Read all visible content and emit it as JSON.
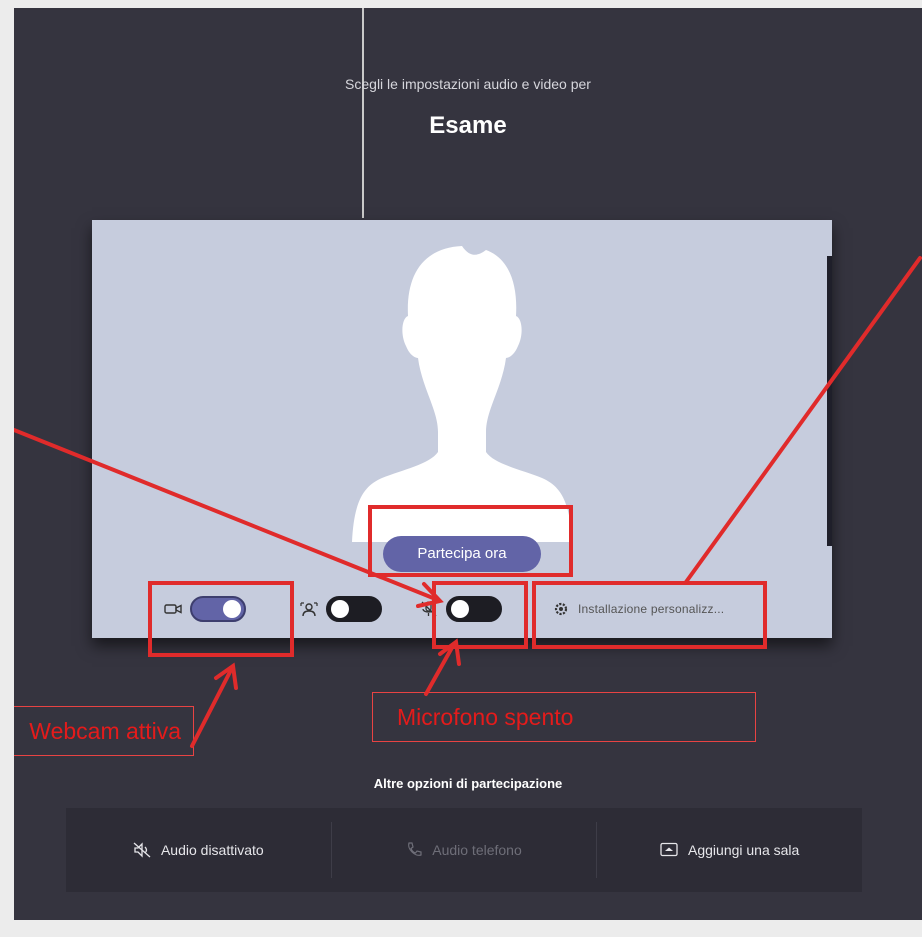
{
  "header": {
    "subtitle": "Scegli le impostazioni audio e video per",
    "meeting_title": "Esame"
  },
  "preview": {
    "join_label": "Partecipa ora",
    "controls": {
      "camera": {
        "state": "on",
        "icon": "camera-icon"
      },
      "background": {
        "state": "off",
        "icon": "background-blur-icon"
      },
      "microphone": {
        "state": "off",
        "icon": "microphone-icon"
      },
      "device": {
        "icon": "gear-icon",
        "label": "Installazione personalizz..."
      }
    }
  },
  "annotations": {
    "webcam_callout": "Webcam attiva",
    "microphone_callout": "Microfono spento",
    "color": "#e02b2b"
  },
  "more_options": {
    "heading": "Altre opzioni di partecipazione",
    "items": [
      {
        "label": "Audio disattivato",
        "icon": "speaker-off-icon",
        "enabled": true
      },
      {
        "label": "Audio telefono",
        "icon": "phone-icon",
        "enabled": false
      },
      {
        "label": "Aggiungi una sala",
        "icon": "room-cast-icon",
        "enabled": true
      }
    ]
  },
  "colors": {
    "background": "#35343f",
    "accent": "#6264a7",
    "preview": "#c6ccdd"
  }
}
